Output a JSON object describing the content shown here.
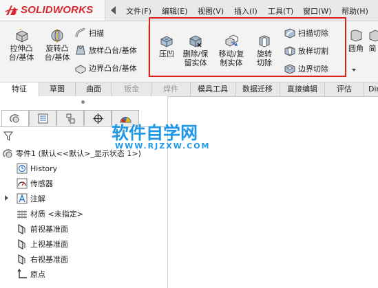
{
  "app": {
    "brand": "SOLIDWORKS"
  },
  "menu": [
    {
      "label": "文件(F)"
    },
    {
      "label": "编辑(E)"
    },
    {
      "label": "视图(V)"
    },
    {
      "label": "插入(I)"
    },
    {
      "label": "工具(T)"
    },
    {
      "label": "窗口(W)"
    },
    {
      "label": "帮助(H)"
    }
  ],
  "ribbon": {
    "extrude_boss": "拉伸凸台/基体",
    "revolve_boss": "旋转凸台/基体",
    "sweep": "扫描",
    "loft_boss": "放样凸台/基体",
    "boundary_boss": "边界凸台/基体",
    "indent": "压凹",
    "delete_keep_body": "删除/保留实体",
    "move_copy_body": "移动/复制实体",
    "revolve_cut": "旋转切除",
    "swept_cut": "扫描切除",
    "loft_cut": "放样切割",
    "boundary_cut": "边界切除",
    "fillet": "圆角",
    "shell": "简"
  },
  "tabs": [
    {
      "label": "特征"
    },
    {
      "label": "草图"
    },
    {
      "label": "曲面"
    },
    {
      "label": "钣金"
    },
    {
      "label": "焊件"
    },
    {
      "label": "模具工具"
    },
    {
      "label": "数据迁移"
    },
    {
      "label": "直接编辑"
    },
    {
      "label": "评估"
    },
    {
      "label": "Dir"
    }
  ],
  "tree": {
    "part": "零件1 (默认<<默认>_显示状态 1>)",
    "items": [
      {
        "label": "History"
      },
      {
        "label": "传感器"
      },
      {
        "label": "注解"
      },
      {
        "label": "材质 <未指定>"
      },
      {
        "label": "前视基准面"
      },
      {
        "label": "上视基准面"
      },
      {
        "label": "右视基准面"
      },
      {
        "label": "原点"
      }
    ]
  },
  "watermark": {
    "title": "软件自学网",
    "url": "WWW.RJZXW.COM"
  },
  "colors": {
    "brand": "#d6262e",
    "highlight": "#d9221c",
    "watermark": "#1f97e6"
  }
}
